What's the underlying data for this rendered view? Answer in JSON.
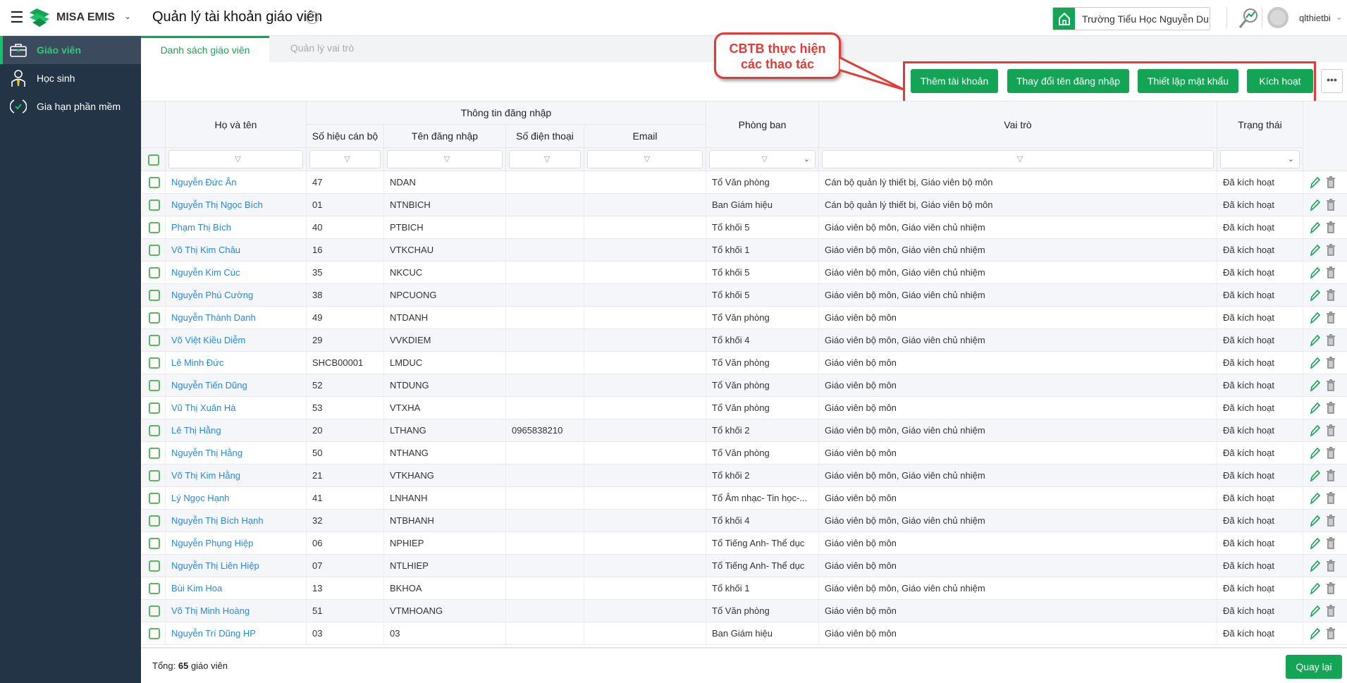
{
  "header": {
    "brand": "MISA EMIS",
    "title": "Quản lý tài khoản giáo viên",
    "help": "?",
    "school": "Trường Tiểu Học Nguyễn Du",
    "user": "qlthietbi"
  },
  "sidebar": {
    "items": [
      {
        "label": "Giáo viên"
      },
      {
        "label": "Học sinh"
      },
      {
        "label": "Gia hạn phần mềm"
      }
    ]
  },
  "tabs": [
    {
      "label": "Danh sách giáo viên"
    },
    {
      "label": "Quản lý vai trò"
    }
  ],
  "callout": {
    "line1": "CBTB thực hiện",
    "line2": "các thao tác"
  },
  "toolbar": {
    "add": "Thêm tài khoản",
    "rename": "Thay đổi tên đăng nhập",
    "password": "Thiết lập mật khẩu",
    "activate": "Kích hoạt",
    "more": "•••"
  },
  "columns": {
    "name": "Họ và tên",
    "login_group": "Thông tin đăng nhập",
    "code": "Số hiệu cán bộ",
    "username": "Tên đăng nhập",
    "phone": "Số điện thoại",
    "email": "Email",
    "dept": "Phòng ban",
    "role": "Vai trò",
    "status": "Trạng thái"
  },
  "filter_icon": "▽",
  "rows": [
    [
      "Nguyễn Đức Ân",
      "47",
      "NDAN",
      "",
      "",
      "Tổ Văn phòng",
      "Cán bộ quản lý thiết bị, Giáo viên bộ môn",
      "Đã kích hoạt"
    ],
    [
      "Nguyễn Thị Ngọc Bích",
      "01",
      "NTNBICH",
      "",
      "",
      "Ban Giám hiệu",
      "Cán bộ quản lý thiết bị, Giáo viên bộ môn",
      "Đã kích hoạt"
    ],
    [
      "Phạm Thị Bích",
      "40",
      "PTBICH",
      "",
      "",
      "Tổ khối 5",
      "Giáo viên bộ môn, Giáo viên chủ nhiệm",
      "Đã kích hoạt"
    ],
    [
      "Võ Thị Kim Châu",
      "16",
      "VTKCHAU",
      "",
      "",
      "Tổ khối 1",
      "Giáo viên bộ môn, Giáo viên chủ nhiệm",
      "Đã kích hoạt"
    ],
    [
      "Nguyễn Kim Cúc",
      "35",
      "NKCUC",
      "",
      "",
      "Tổ khối 5",
      "Giáo viên bộ môn, Giáo viên chủ nhiệm",
      "Đã kích hoạt"
    ],
    [
      "Nguyễn Phú Cường",
      "38",
      "NPCUONG",
      "",
      "",
      "Tổ khối 5",
      "Giáo viên bộ môn, Giáo viên chủ nhiệm",
      "Đã kích hoạt"
    ],
    [
      "Nguyễn Thành Danh",
      "49",
      "NTDANH",
      "",
      "",
      "Tổ Văn phòng",
      "Giáo viên bộ môn",
      "Đã kích hoạt"
    ],
    [
      "Võ Việt Kiều Diễm",
      "29",
      "VVKDIEM",
      "",
      "",
      "Tổ khối 4",
      "Giáo viên bộ môn, Giáo viên chủ nhiệm",
      "Đã kích hoạt"
    ],
    [
      "Lê Minh Đức",
      "SHCB00001",
      "LMDUC",
      "",
      "",
      "Tổ Văn phòng",
      "Giáo viên bộ môn",
      "Đã kích hoạt"
    ],
    [
      "Nguyễn Tiến Dũng",
      "52",
      "NTDUNG",
      "",
      "",
      "Tổ Văn phòng",
      "Giáo viên bộ môn",
      "Đã kích hoạt"
    ],
    [
      "Vũ Thị Xuân Hà",
      "53",
      "VTXHA",
      "",
      "",
      "Tổ Văn phòng",
      "Giáo viên bộ môn",
      "Đã kích hoạt"
    ],
    [
      "Lê Thị Hằng",
      "20",
      "LTHANG",
      "0965838210",
      "",
      "Tổ khối 2",
      "Giáo viên bộ môn, Giáo viên chủ nhiệm",
      "Đã kích hoạt"
    ],
    [
      "Nguyễn Thị Hằng",
      "50",
      "NTHANG",
      "",
      "",
      "Tổ Văn phòng",
      "Giáo viên bộ môn",
      "Đã kích hoạt"
    ],
    [
      "Võ Thị Kim Hằng",
      "21",
      "VTKHANG",
      "",
      "",
      "Tổ khối 2",
      "Giáo viên bộ môn, Giáo viên chủ nhiệm",
      "Đã kích hoạt"
    ],
    [
      "Lý Ngọc Hạnh",
      "41",
      "LNHANH",
      "",
      "",
      "Tổ Âm nhạc- Tin học-...",
      "Giáo viên bộ môn",
      "Đã kích hoạt"
    ],
    [
      "Nguyễn Thị Bích Hạnh",
      "32",
      "NTBHANH",
      "",
      "",
      "Tổ khối 4",
      "Giáo viên bộ môn, Giáo viên chủ nhiệm",
      "Đã kích hoạt"
    ],
    [
      "Nguyễn Phụng Hiệp",
      "06",
      "NPHIEP",
      "",
      "",
      "Tổ Tiếng Anh- Thể dục",
      "Giáo viên bộ môn",
      "Đã kích hoạt"
    ],
    [
      "Nguyễn Thị Liên Hiệp",
      "07",
      "NTLHIEP",
      "",
      "",
      "Tổ Tiếng Anh- Thể dục",
      "Giáo viên bộ môn",
      "Đã kích hoạt"
    ],
    [
      "Bùi Kim Hoa",
      "13",
      "BKHOA",
      "",
      "",
      "Tổ khối 1",
      "Giáo viên bộ môn, Giáo viên chủ nhiệm",
      "Đã kích hoạt"
    ],
    [
      "Võ Thị Minh Hoàng",
      "51",
      "VTMHOANG",
      "",
      "",
      "Tổ Văn phòng",
      "Giáo viên bộ môn",
      "Đã kích hoạt"
    ],
    [
      "Nguyễn Trí Dũng HP",
      "03",
      "03",
      "",
      "",
      "Ban Giám hiệu",
      "Giáo viên bộ môn",
      "Đã kích hoạt"
    ]
  ],
  "footer": {
    "total_prefix": "Tổng: ",
    "total_count": "65",
    "total_suffix": " giáo viên",
    "back": "Quay lại"
  },
  "colors": {
    "accent": "#13a455",
    "sidebar": "#243447",
    "link": "#2d86d9",
    "annotation": "#e53935"
  }
}
